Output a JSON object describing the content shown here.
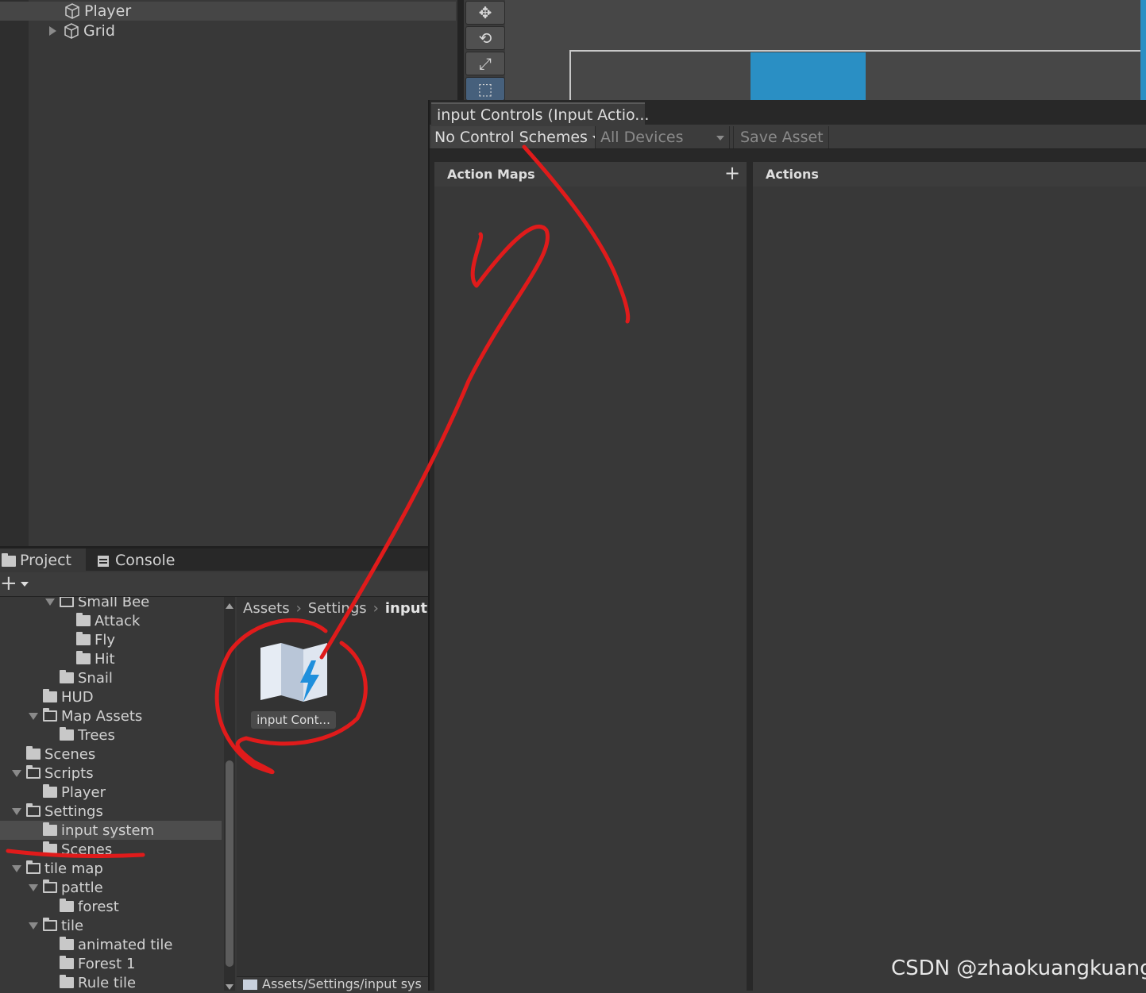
{
  "hierarchy": {
    "items": [
      {
        "label": "Player",
        "selected": true
      },
      {
        "label": "Grid",
        "expandable": true
      }
    ]
  },
  "scene": {
    "tools": [
      "move-tool",
      "rotate-tool",
      "scale-tool",
      "rect-tool"
    ],
    "active_tool": "rect-tool"
  },
  "input_window": {
    "tab_title": "input Controls (Input Actio...",
    "control_schemes": "No Control Schemes",
    "devices": "All Devices",
    "save_asset": "Save Asset",
    "action_maps_title": "Action Maps",
    "add_map": "+",
    "actions_title": "Actions"
  },
  "project": {
    "tabs": [
      "Project",
      "Console"
    ],
    "add_label": "+",
    "tree": [
      {
        "label": "Small Bee",
        "depth": 3,
        "expanded": true
      },
      {
        "label": "Attack",
        "depth": 4
      },
      {
        "label": "Fly",
        "depth": 4
      },
      {
        "label": "Hit",
        "depth": 4
      },
      {
        "label": "Snail",
        "depth": 3
      },
      {
        "label": "HUD",
        "depth": 2
      },
      {
        "label": "Map Assets",
        "depth": 2,
        "expanded": true
      },
      {
        "label": "Trees",
        "depth": 3
      },
      {
        "label": "Scenes",
        "depth": 1
      },
      {
        "label": "Scripts",
        "depth": 1,
        "expanded": true
      },
      {
        "label": "Player",
        "depth": 2
      },
      {
        "label": "Settings",
        "depth": 1,
        "expanded": true
      },
      {
        "label": "input system",
        "depth": 2,
        "selected": true
      },
      {
        "label": "Scenes",
        "depth": 2
      },
      {
        "label": "tile map",
        "depth": 1,
        "expanded": true
      },
      {
        "label": "pattle",
        "depth": 2,
        "expanded": true
      },
      {
        "label": "forest",
        "depth": 3
      },
      {
        "label": "tile",
        "depth": 2,
        "expanded": true
      },
      {
        "label": "animated tile",
        "depth": 3
      },
      {
        "label": "Forest 1",
        "depth": 3
      },
      {
        "label": "Rule tile",
        "depth": 3
      }
    ],
    "breadcrumb": [
      "Assets",
      "Settings",
      "input s"
    ],
    "asset": {
      "label": "input Cont...",
      "icon": "input-actions-map-icon"
    },
    "path": "Assets/Settings/input sys"
  },
  "colors": {
    "annotation": "#e01b1b",
    "selection_blue": "#46607c",
    "tile_blue": "#2a8fc4"
  },
  "watermark": "CSDN @zhaokuangkuang_"
}
